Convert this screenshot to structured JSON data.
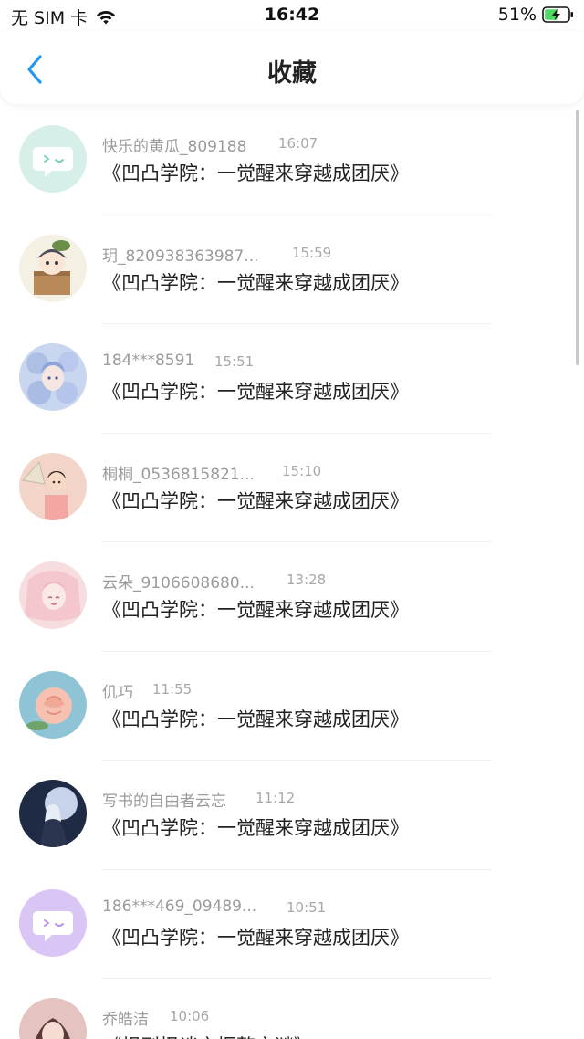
{
  "status_bar": {
    "carrier": "无 SIM 卡",
    "time": "16:42",
    "battery": "51%",
    "battery_color": "#4cd964"
  },
  "nav": {
    "title": "收藏",
    "back_icon": "chevron-left-icon",
    "accent": "#2196f3"
  },
  "items": [
    {
      "username": "快乐的黄瓜_809188",
      "time": "16:07",
      "title": "《凹凸学院：一觉醒来穿越成团厌》",
      "avatar": "chat-bubble-icon",
      "avatar_color": "#d6efe9"
    },
    {
      "username": "玥_820938363987...",
      "time": "15:59",
      "title": "《凹凸学院：一觉醒来穿越成团厌》",
      "avatar": "anime-character-box",
      "avatar_color": "#f4f1e4"
    },
    {
      "username": "184***8591",
      "time": "15:51",
      "title": "《凹凸学院：一觉醒来穿越成团厌》",
      "avatar": "anime-girl-blue",
      "avatar_color": "#c9d6ef"
    },
    {
      "username": "桐桐_0536815821...",
      "time": "15:10",
      "title": "《凹凸学院：一觉醒来穿越成团厌》",
      "avatar": "girl-with-fan-photo",
      "avatar_color": "#f2d4c8"
    },
    {
      "username": "云朵_9106608680...",
      "time": "13:28",
      "title": "《凹凸学院：一觉醒来穿越成团厌》",
      "avatar": "anime-girl-pink",
      "avatar_color": "#f7dde0"
    },
    {
      "username": "仉巧",
      "time": "11:55",
      "title": "《凹凸学院：一觉醒来穿越成团厌》",
      "avatar": "rose-photo",
      "avatar_color": "#8fc3d6"
    },
    {
      "username": "写书的自由者云忘",
      "time": "11:12",
      "title": "《凹凸学院：一觉醒来穿越成团厌》",
      "avatar": "moon-character",
      "avatar_color": "#1f2b45"
    },
    {
      "username": "186***469_09489...",
      "time": "10:51",
      "title": "《凹凸学院：一觉醒来穿越成团厌》",
      "avatar": "chat-bubble-icon",
      "avatar_color": "#d9c6f5"
    },
    {
      "username": "乔皓洁",
      "time": "10:06",
      "title": "《规则怪谈之振整之谜》",
      "avatar": "girl-photo",
      "avatar_color": "#e5c3c0"
    }
  ]
}
